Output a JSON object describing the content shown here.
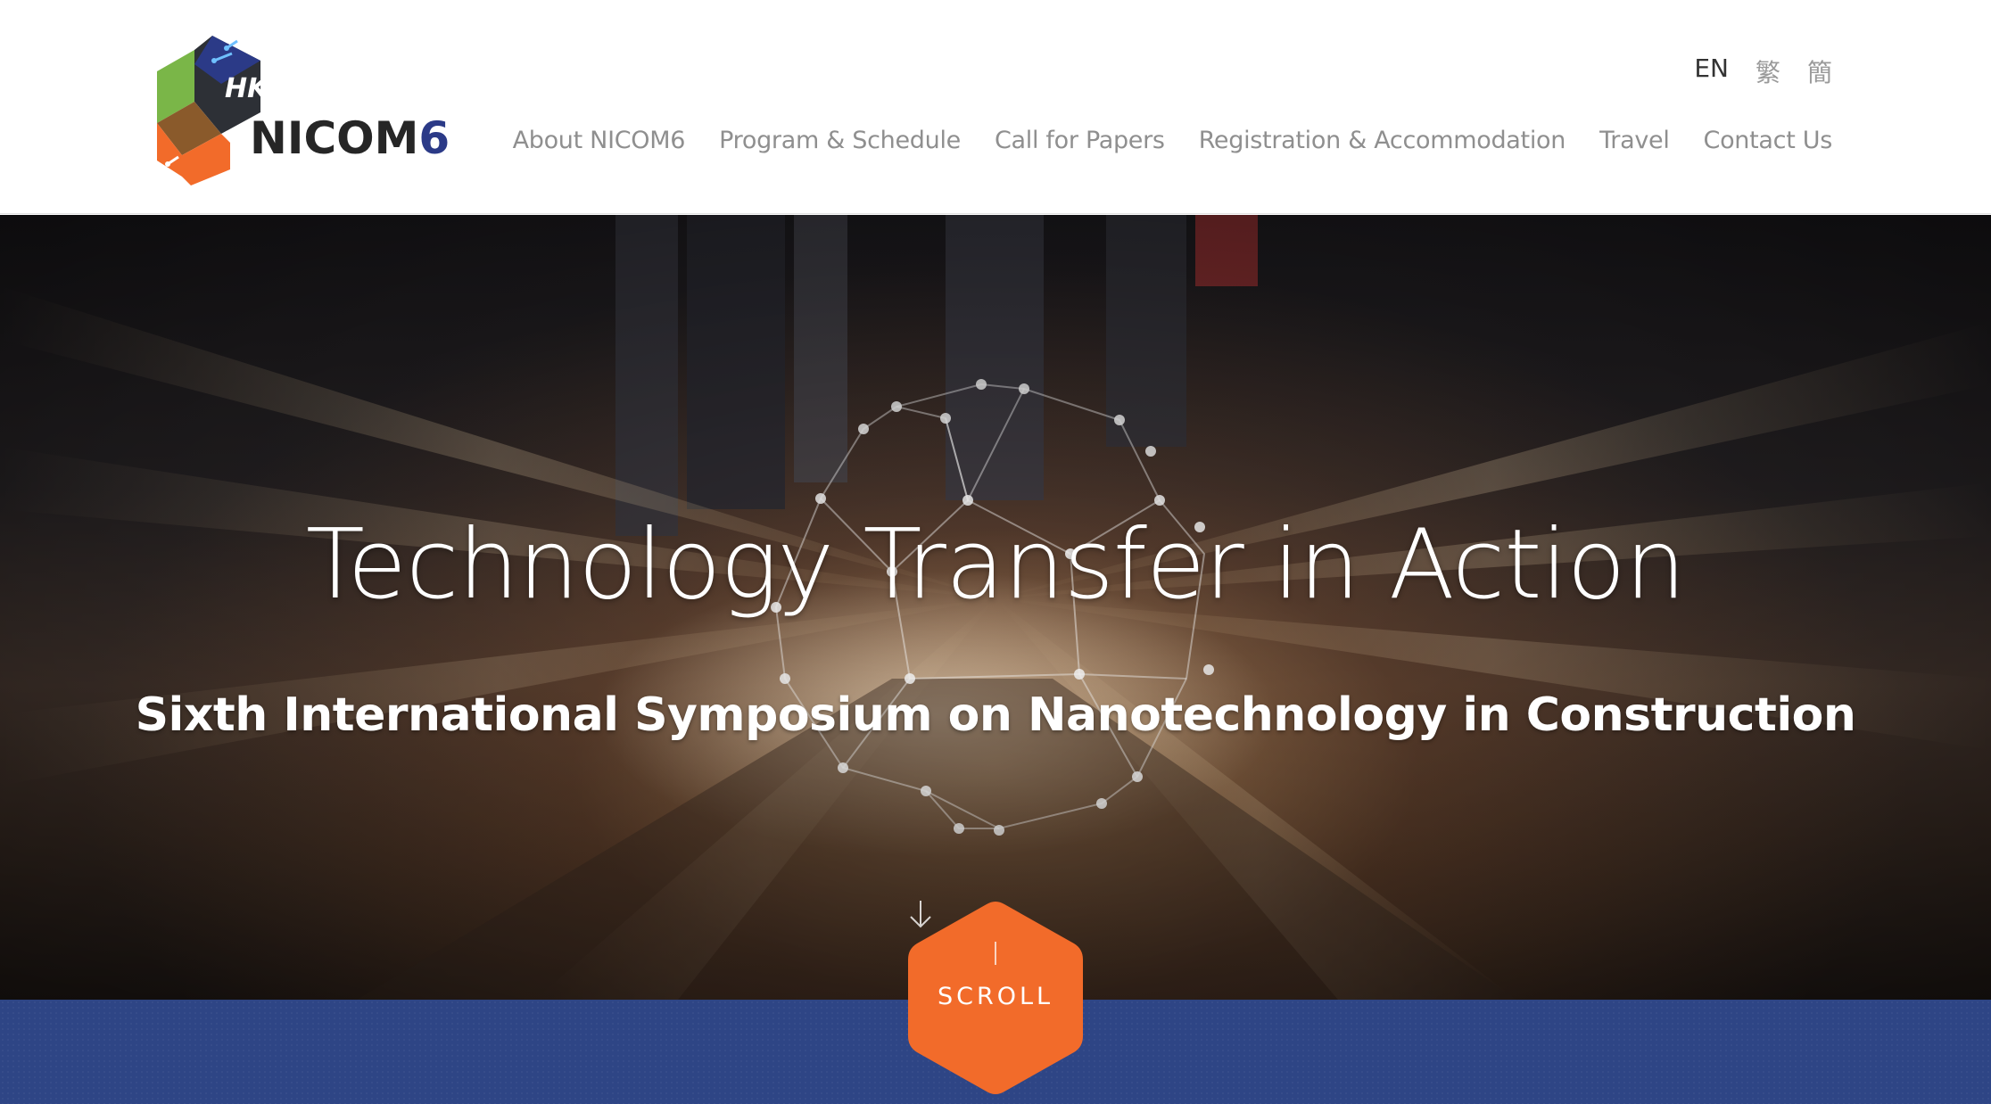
{
  "brand": {
    "logo_badge": "HK",
    "name_prefix": "NICOM",
    "name_suffix": "6"
  },
  "languages": [
    {
      "label": "EN",
      "active": true
    },
    {
      "label": "繁",
      "active": false
    },
    {
      "label": "簡",
      "active": false
    }
  ],
  "nav": {
    "items": [
      {
        "label": "About NICOM6"
      },
      {
        "label": "Program & Schedule"
      },
      {
        "label": "Call for Papers"
      },
      {
        "label": "Registration & Accommodation"
      },
      {
        "label": "Travel"
      },
      {
        "label": "Contact Us"
      }
    ]
  },
  "hero": {
    "title": "Technology Transfer in Action",
    "subtitle": "Sixth International Symposium on Nanotechnology in Construction"
  },
  "scroll": {
    "label": "SCROLL"
  },
  "colors": {
    "accent_orange": "#f26b2a",
    "band_blue": "#2e4585",
    "logo_green": "#7ab648",
    "logo_brown": "#8a5a2b",
    "logo_navy": "#2b3a87",
    "logo_dark": "#2d3036"
  }
}
